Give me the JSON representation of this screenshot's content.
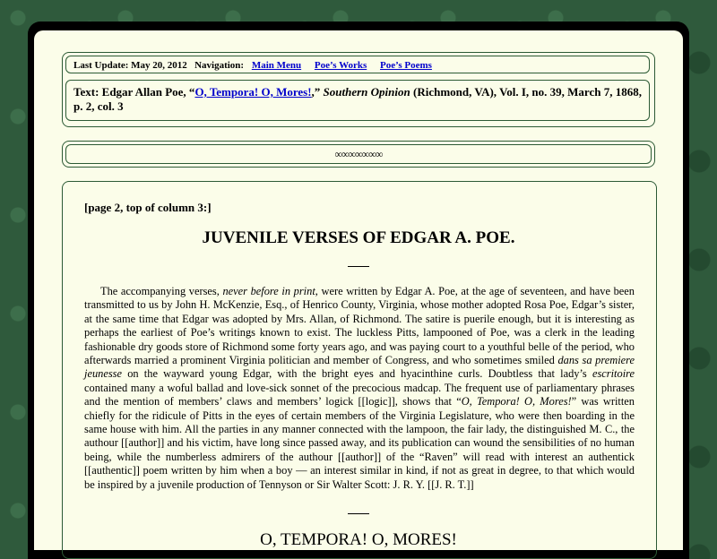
{
  "nav": {
    "last_update": "Last Update: May 20, 2012",
    "navigation_label": "Navigation:",
    "links": [
      "Main Menu",
      "Poe’s Works",
      "Poe’s Poems"
    ]
  },
  "citation": {
    "prefix": "Text: Edgar Allan Poe, “",
    "title_link": "O, Tempora! O, Mores!",
    "after_title": ",” ",
    "journal": "Southern Opinion",
    "rest": " (Richmond, VA), Vol. I, no. 39, March 7, 1868, p. 2, col. 3"
  },
  "separator": "∞∞∞∞∞∞∞",
  "main": {
    "page_note": "[page 2, top of column 3:]",
    "title": "JUVENILE VERSES OF EDGAR A. POE.",
    "paragraph": [
      {
        "t": "The accompanying verses, "
      },
      {
        "t": "never before in print",
        "i": true
      },
      {
        "t": ", were written by Edgar A. Poe, at the age of seventeen, and have been transmitted to us by John H. McKenzie, Esq., of Henrico County, Virginia, whose mother adopted Rosa Poe, Edgar’s sister, at the same time that Edgar was adopted by Mrs. Allan, of Richmond. The satire is puerile enough, but it is interesting as perhaps the earliest of Poe’s writings known to exist. The luckless Pitts, lampooned of Poe, was a clerk in the leading fashionable dry goods store of Richmond some forty years ago, and was paying court to a youthful belle of the period, who afterwards married a prominent Virginia politician and member of Congress, and who sometimes smiled "
      },
      {
        "t": "dans sa premiere jeunesse",
        "i": true
      },
      {
        "t": " on the wayward young Edgar, with the bright eyes and hyacinthine curls. Doubtless that lady’s "
      },
      {
        "t": "escritoire",
        "i": true
      },
      {
        "t": " contained many a woful ballad and love-sick sonnet of the precocious madcap. The frequent use of parliamentary phrases and the mention of members’ claws and members’ logick [[logic]], shows that “"
      },
      {
        "t": "O, Tempora! O, Mores!",
        "i": true
      },
      {
        "t": "” was written chiefly for the ridicule of Pitts in the eyes of certain members of the Virginia Legislature, who were then boarding in the same house with him. All the parties in any manner connected with the lampoon, the fair lady, the distinguished M. C., the authour [[author]] and his victim, have long since passed away, and its publication can wound the sensibilities of no human being, while the numberless admirers of the authour [[author]] of the “Raven” will read with interest an authentick [[authentic]] poem written by him when a boy — an interest similar in kind, if not as great in degree, to that which would be inspired by a juvenile production of Tennyson or Sir Walter Scott: J. R. Y. [[J. R. T.]]"
      }
    ],
    "poem_title": "O, TEMPORA! O, MORES!"
  }
}
